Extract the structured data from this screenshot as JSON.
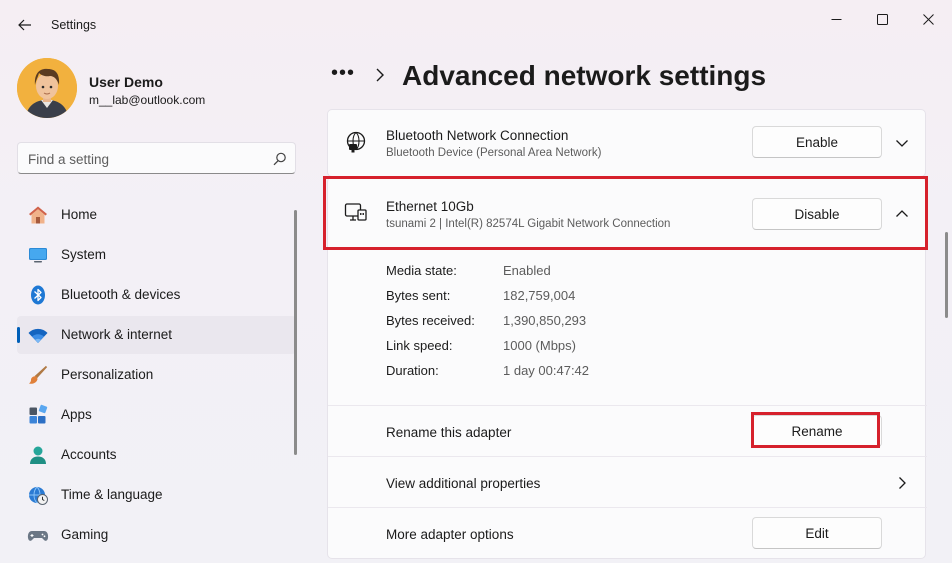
{
  "window": {
    "title": "Settings"
  },
  "user": {
    "name": "User Demo",
    "email": "m__lab@outlook.com"
  },
  "search": {
    "placeholder": "Find a setting"
  },
  "nav": {
    "items": [
      {
        "label": "Home",
        "icon": "home-icon"
      },
      {
        "label": "System",
        "icon": "system-icon"
      },
      {
        "label": "Bluetooth & devices",
        "icon": "bluetooth-icon"
      },
      {
        "label": "Network & internet",
        "icon": "wifi-icon",
        "active": true
      },
      {
        "label": "Personalization",
        "icon": "brush-icon"
      },
      {
        "label": "Apps",
        "icon": "apps-icon"
      },
      {
        "label": "Accounts",
        "icon": "accounts-icon"
      },
      {
        "label": "Time & language",
        "icon": "clock-globe-icon"
      },
      {
        "label": "Gaming",
        "icon": "gamepad-icon"
      }
    ]
  },
  "breadcrumb": {
    "overflow": "•••",
    "title": "Advanced network settings"
  },
  "adapters": {
    "bluetooth": {
      "name": "Bluetooth Network Connection",
      "description": "Bluetooth Device (Personal Area Network)",
      "button": "Enable"
    },
    "ethernet": {
      "name": "Ethernet 10Gb",
      "description": "tsunami 2 | Intel(R) 82574L Gigabit Network Connection",
      "button": "Disable",
      "properties": [
        {
          "label": "Media state:",
          "value": "Enabled"
        },
        {
          "label": "Bytes sent:",
          "value": "182,759,004"
        },
        {
          "label": "Bytes received:",
          "value": "1,390,850,293"
        },
        {
          "label": "Link speed:",
          "value": "1000 (Mbps)"
        },
        {
          "label": "Duration:",
          "value": "1 day 00:47:42"
        }
      ],
      "rename": {
        "label": "Rename this adapter",
        "button": "Rename"
      },
      "view_properties": {
        "label": "View additional properties"
      },
      "more_options": {
        "label": "More adapter options",
        "button": "Edit"
      }
    }
  },
  "colors": {
    "accent": "#005fb8",
    "highlight": "#d6212c"
  }
}
